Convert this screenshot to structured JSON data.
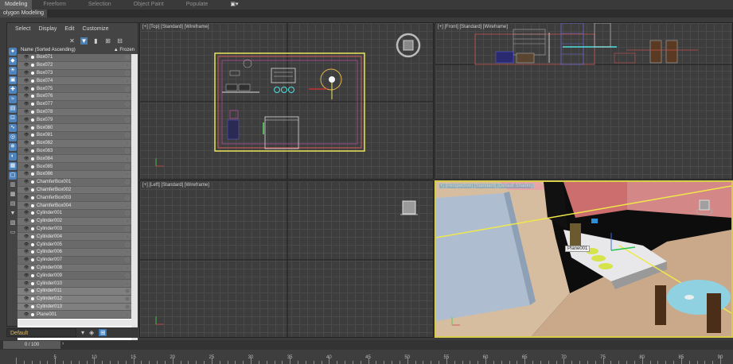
{
  "ribbon": {
    "tabs": [
      {
        "label": "Modeling",
        "active": true
      },
      {
        "label": "Freeform",
        "active": false
      },
      {
        "label": "Selection",
        "active": false
      },
      {
        "label": "Object Paint",
        "active": false
      },
      {
        "label": "Populate",
        "active": false
      }
    ],
    "extra_icon": "camera-icon",
    "subtitle": "olygon Modeling"
  },
  "explorer": {
    "menu": [
      "Select",
      "Display",
      "Edit",
      "Customize"
    ],
    "header_name": "Name (Sorted Ascending)",
    "header_frozen": "▲ Frozen",
    "items": [
      "Box071",
      "Box072",
      "Box073",
      "Box074",
      "Box075",
      "Box076",
      "Box077",
      "Box078",
      "Box079",
      "Box080",
      "Box081",
      "Box082",
      "Box083",
      "Box084",
      "Box085",
      "Box086",
      "ChamferBox001",
      "ChamferBox002",
      "ChamferBox003",
      "ChamferBox004",
      "Cylinder001",
      "Cylinder002",
      "Cylinder003",
      "Cylinder004",
      "Cylinder005",
      "Cylinder006",
      "Cylinder007",
      "Cylinder008",
      "Cylinder009",
      "Cylinder010",
      "Cylinder011",
      "Cylinder012",
      "Cylinder013",
      "Plane001"
    ],
    "selected_items": [
      "Cylinder011",
      "Cylinder012",
      "Cylinder013"
    ]
  },
  "layer": {
    "current": "Default"
  },
  "time": {
    "slider_label": "0 / 100",
    "ticks": [
      "0",
      "5",
      "10",
      "15",
      "20",
      "25",
      "30",
      "35",
      "40",
      "45",
      "50",
      "55",
      "60",
      "65",
      "70",
      "75",
      "80",
      "85",
      "90"
    ]
  },
  "viewports": {
    "top": {
      "label": "[+] [Top] [Standard] [Wireframe]"
    },
    "front": {
      "label": "[+] [Front] [Standard] [Wireframe]"
    },
    "left": {
      "label": "[+] [Left] [Standard] [Wireframe]"
    },
    "persp": {
      "label": "[+] [Perspective] [Standard] [Default Shading]",
      "tooltip": "Plane001"
    }
  },
  "colors": {
    "active_tab": "#5a5a5a",
    "accent_blue": "#4e83bb",
    "viewport_active_border": "#d9cc4a",
    "layer_text": "#d8b96e"
  }
}
